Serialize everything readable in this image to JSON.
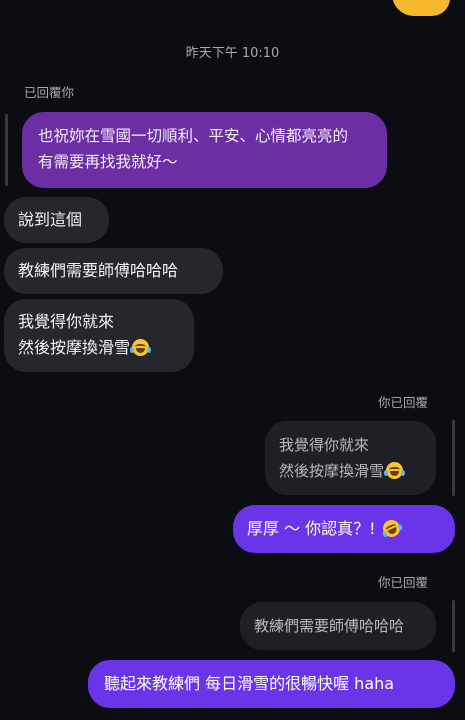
{
  "timestamp": "昨天下午 10:10",
  "reply_header_1": "已回覆你",
  "quoted_message_1": [
    "也祝妳在雪國一切順利、平安、心情都亮亮的",
    "有需要再找我就好～"
  ],
  "received": {
    "msg1": "說到這個",
    "msg2": "教練們需要師傅哈哈哈",
    "msg3_line1": "我覺得你就來",
    "msg3_line2": "然後按摩換滑雪"
  },
  "reply_header_2": "你已回覆",
  "quoted_message_2": [
    "我覺得你就來",
    "然後按摩換滑雪"
  ],
  "sent_1": "厚厚 ～ 你認真？! ",
  "reply_header_3": "你已回覆",
  "quoted_message_3": "教練們需要師傅哈哈哈",
  "sent_2": "聽起來教練們 每日滑雪的很暢快喔 haha",
  "icons": {
    "top_reaction": "thumbs-up-emoji",
    "crying_laughing": "face-with-tears-of-joy-emoji",
    "rolling_laughing": "rolling-on-floor-laughing-emoji"
  },
  "colors": {
    "background": "#0c0d12",
    "received_bubble": "#26272c",
    "sent_bubble": "#6a35e8",
    "quoted_purple": "#6b2fa3"
  }
}
